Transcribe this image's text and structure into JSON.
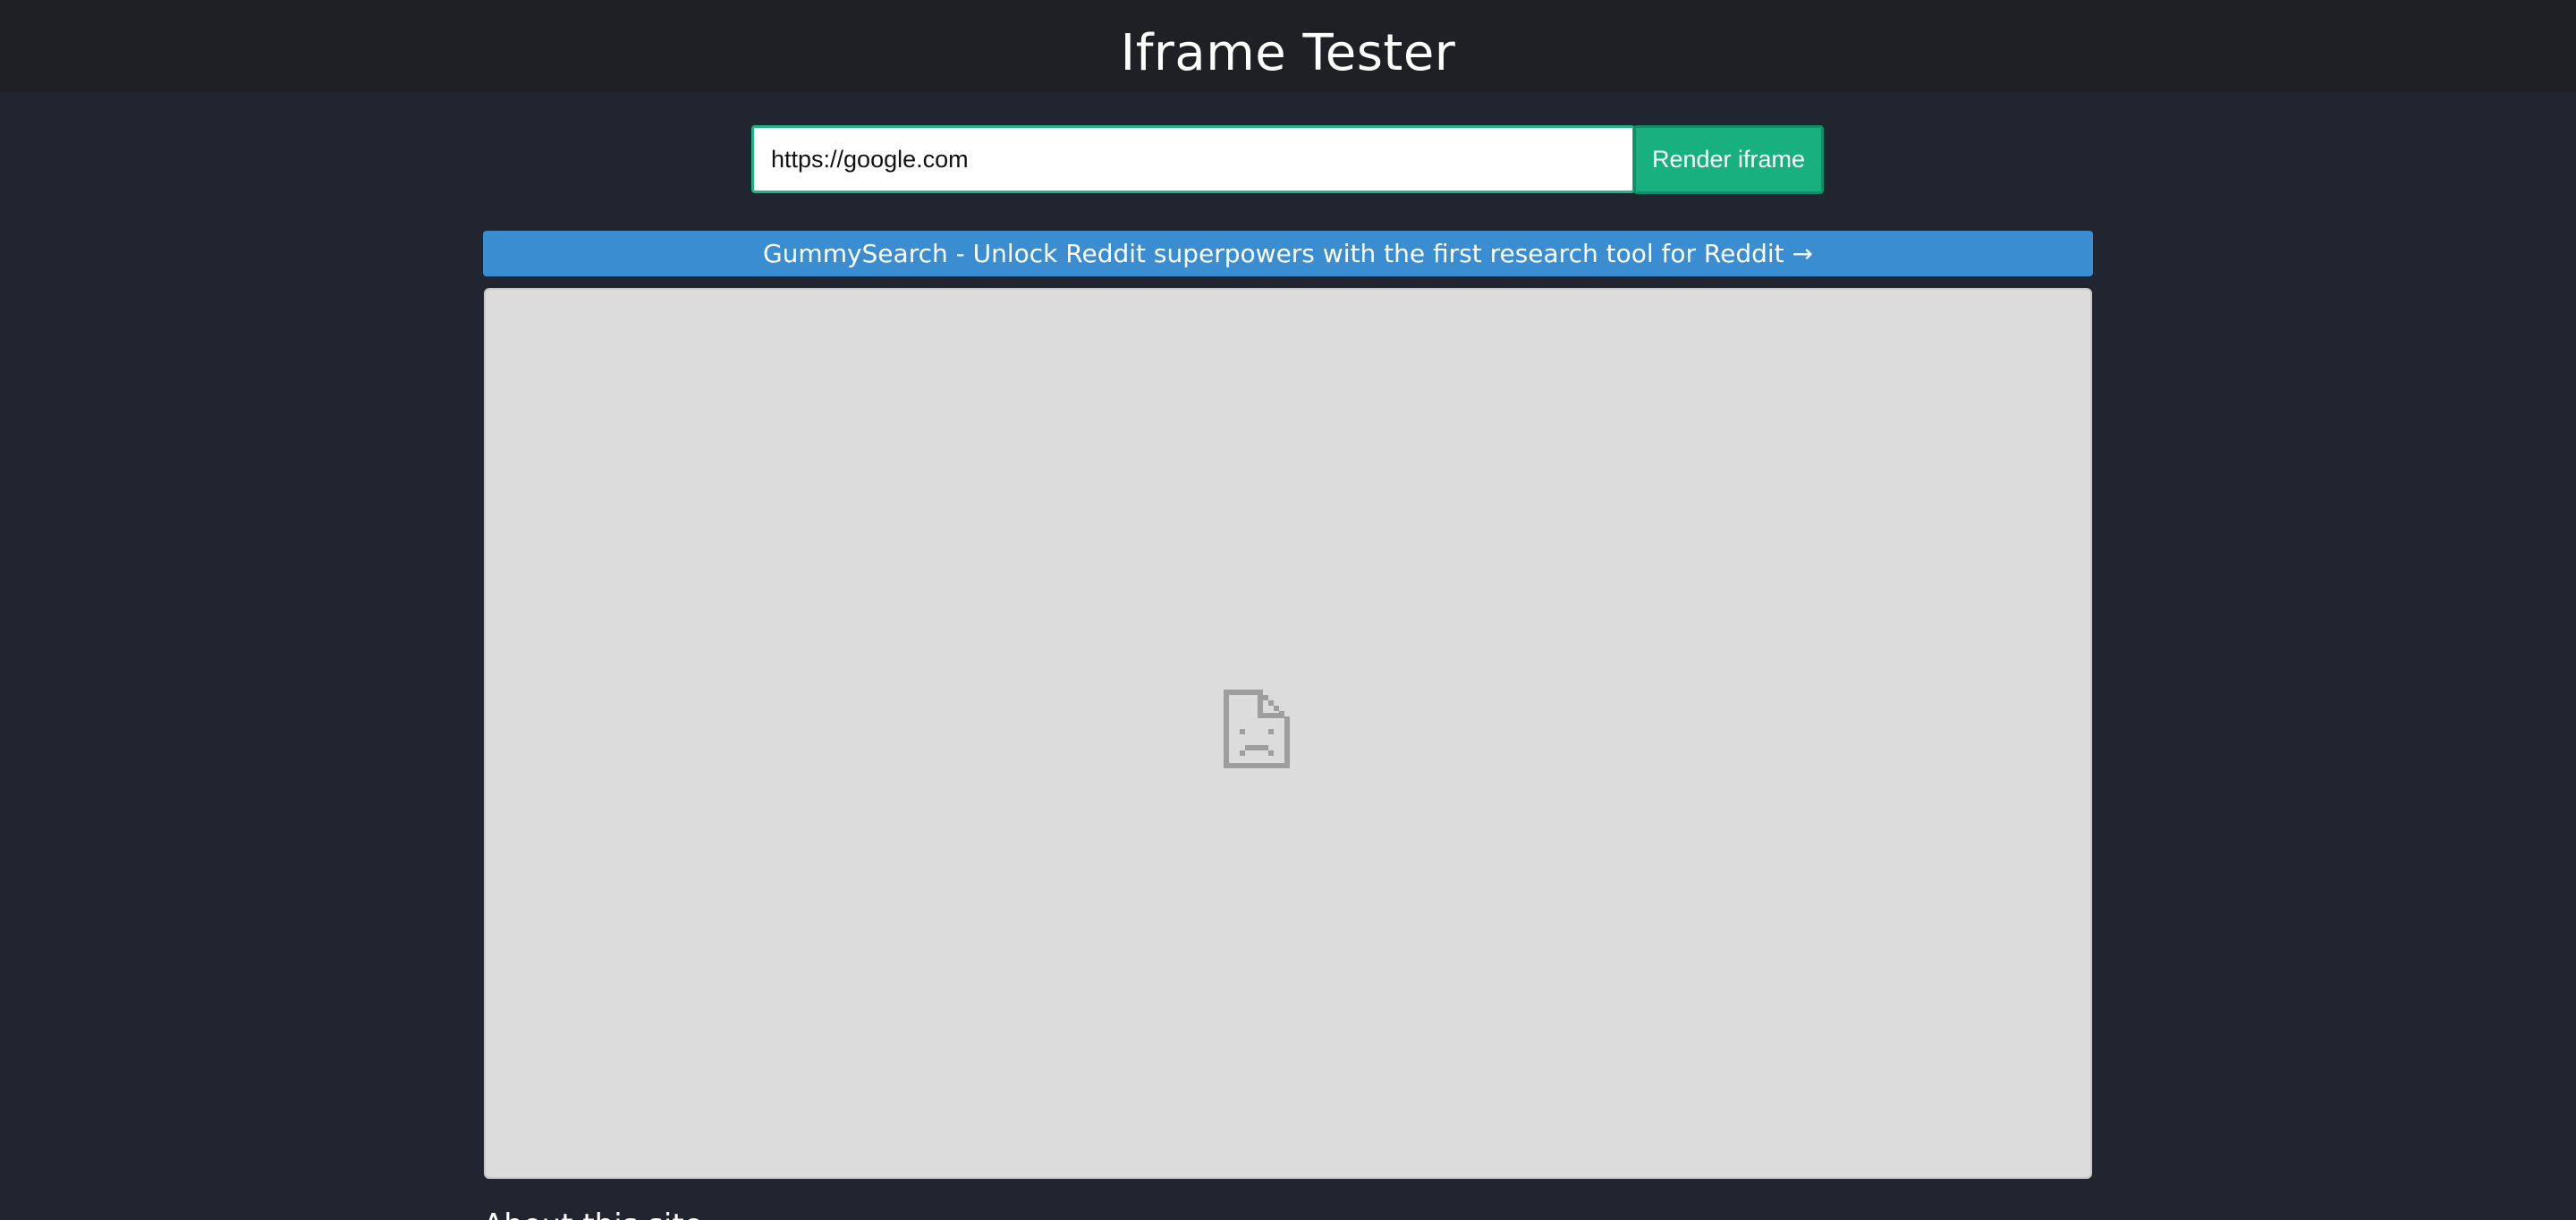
{
  "header": {
    "title": "Iframe Tester"
  },
  "form": {
    "url_value": "https://google.com",
    "render_button_label": "Render iframe"
  },
  "promo": {
    "text": "GummySearch - Unlock Reddit superpowers with the first research tool for Reddit →"
  },
  "iframe": {
    "status_icon": "sad-document-icon"
  },
  "section": {
    "heading": "About this site"
  },
  "colors": {
    "background": "#21252f",
    "header_background": "#1e2026",
    "accent_green": "#19b080",
    "promo_blue": "#3a8dd0",
    "iframe_background": "#dcdcdc"
  }
}
